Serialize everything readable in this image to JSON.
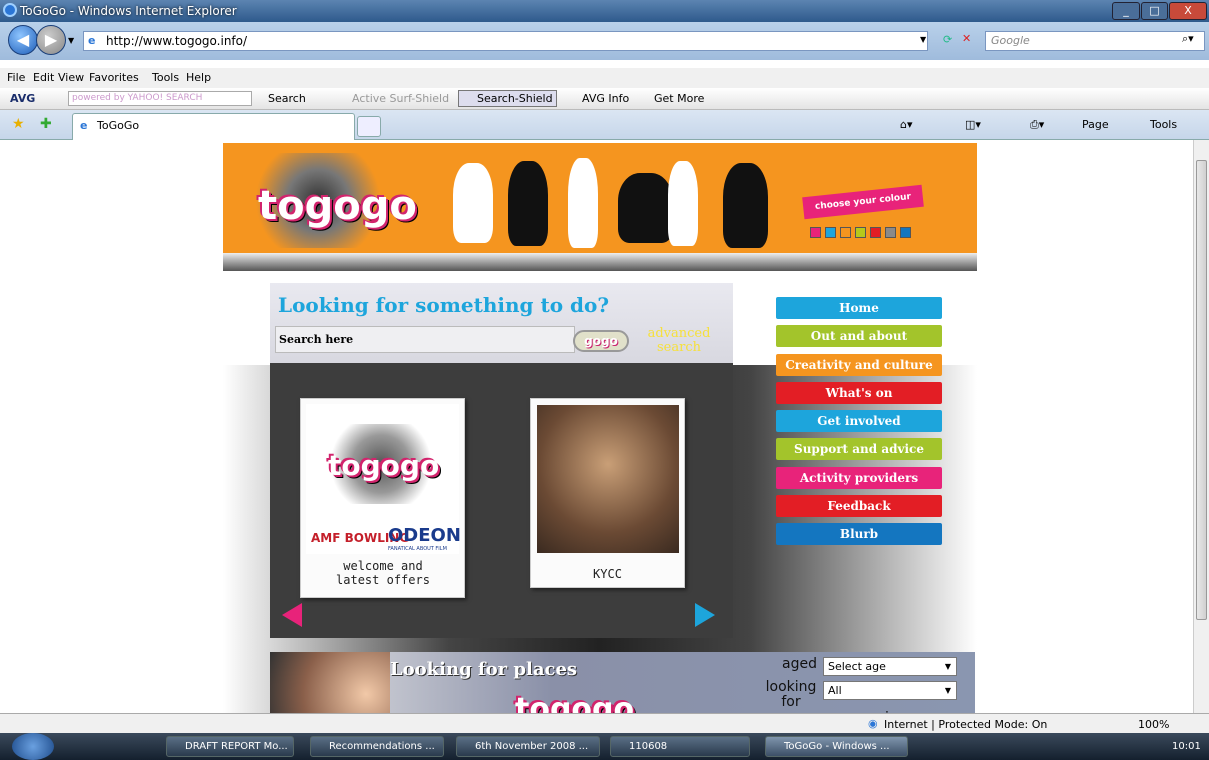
{
  "window": {
    "title": "ToGoGo - Windows Internet Explorer",
    "controls": {
      "minimize": "_",
      "maximize": "□",
      "close": "X"
    }
  },
  "address": {
    "url": "http://www.togogo.info/",
    "search_placeholder": "Google"
  },
  "menu": [
    "File",
    "Edit",
    "View",
    "Favorites",
    "Tools",
    "Help"
  ],
  "avg_toolbar": {
    "brand": "AVG",
    "yahoo": "powered by YAHOO! SEARCH",
    "search": "Search",
    "active_surf": "Active  Surf-Shield",
    "search_shield": "Search-Shield",
    "avg_info": "AVG Info",
    "get_more": "Get More"
  },
  "tab": {
    "label": "ToGoGo"
  },
  "command_bar": {
    "page": "Page",
    "tools": "Tools"
  },
  "site": {
    "logo": "togogo",
    "choose_colour": "choose your colour",
    "swatches": [
      "#e8237a",
      "#1da5dc",
      "#f5951f",
      "#b5c91c",
      "#e31e25",
      "#8a8a8a",
      "#1476c0"
    ],
    "looking_title": "Looking for something to do?",
    "search_label": "Search here",
    "gogo": "gogo",
    "advanced_search": "advanced search",
    "cards": [
      {
        "logo": "togogo",
        "brands": [
          "AMF BOWLING",
          "ODEON"
        ],
        "odeon_tag": "FANATICAL ABOUT FILM",
        "caption": "welcome and latest offers"
      },
      {
        "caption": "KYCC"
      }
    ],
    "nav": [
      {
        "label": "Home",
        "color": "#1da5dc"
      },
      {
        "label": "Out and about",
        "color": "#a3c42b"
      },
      {
        "label": "Creativity and culture",
        "color": "#f5951f"
      },
      {
        "label": "What's on",
        "color": "#e31e25"
      },
      {
        "label": "Get involved",
        "color": "#1da5dc"
      },
      {
        "label": "Support and advice",
        "color": "#a3c42b"
      },
      {
        "label": "Activity providers",
        "color": "#e8237a"
      },
      {
        "label": "Feedback",
        "color": "#e31e25"
      },
      {
        "label": "Blurb",
        "color": "#1476c0"
      }
    ],
    "places_title": "Looking for places",
    "aged_label": "aged",
    "aged_value": "Select age",
    "looking_for_label": "looking for",
    "looking_for_value": "All",
    "in_label": "in"
  },
  "status": {
    "zone": "Internet | Protected Mode: On",
    "zoom": "100%"
  },
  "taskbar": {
    "items": [
      "DRAFT REPORT Mo...",
      "Recommendations ...",
      "6th November 2008 ...",
      "110608",
      "ToGoGo - Windows ..."
    ],
    "clock": "10:01"
  }
}
